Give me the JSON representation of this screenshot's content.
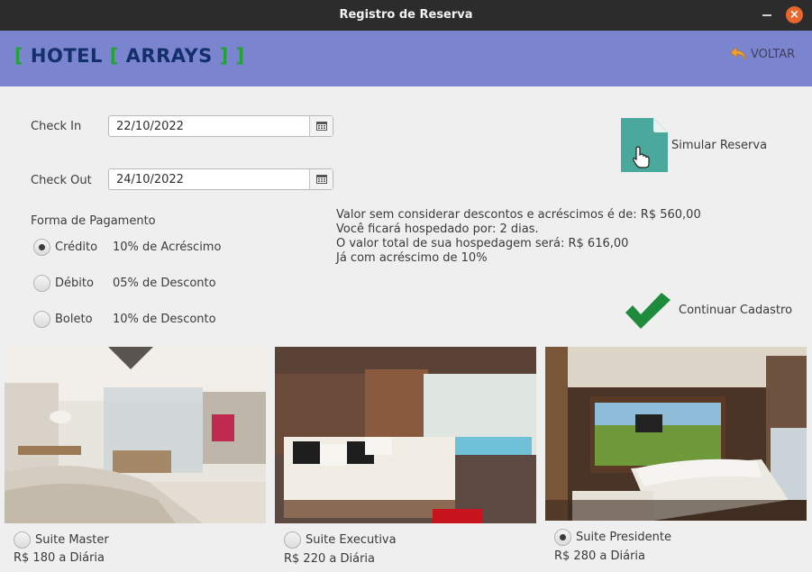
{
  "window": {
    "title": "Registro de Reserva",
    "close_glyph": "×"
  },
  "header": {
    "logo": {
      "open1": "[",
      "word1": "HOTEL",
      "open2": "[",
      "word2": "ARRAYS",
      "close": "] ]"
    },
    "back_label": "VOLTAR"
  },
  "form": {
    "checkin_label": "Check In",
    "checkin_value": "22/10/2022",
    "checkout_label": "Check Out",
    "checkout_value": "24/10/2022",
    "payment_title": "Forma de Pagamento",
    "payments": [
      {
        "name": "Crédito",
        "desc": "10% de Acréscimo",
        "checked": true
      },
      {
        "name": "Débito",
        "desc": "05% de Desconto",
        "checked": false
      },
      {
        "name": "Boleto",
        "desc": "10% de Desconto",
        "checked": false
      }
    ]
  },
  "actions": {
    "simulate_label": "Simular Reserva",
    "continue_label": "Continuar Cadastro"
  },
  "summary": {
    "line1": "Valor sem considerar descontos e acréscimos é de: R$ 560,00",
    "line2": "Você ficará hospedado por: 2 dias.",
    "line3": "O valor total de sua hospedagem será: R$ 616,00",
    "line4": "Já com acréscimo de 10%"
  },
  "rooms": [
    {
      "name": "Suite Master",
      "price": "R$ 180 a Diária",
      "checked": false
    },
    {
      "name": "Suite Executiva",
      "price": "R$ 220 a Diária",
      "checked": false
    },
    {
      "name": "Suite Presidente",
      "price": "R$ 280 a Diária",
      "checked": true
    }
  ],
  "colors": {
    "header_bg": "#7b84cf",
    "logo_bracket": "#21a336",
    "logo_text": "#13306b",
    "check_green": "#1e8a3c",
    "doc_teal": "#4aa99c"
  }
}
